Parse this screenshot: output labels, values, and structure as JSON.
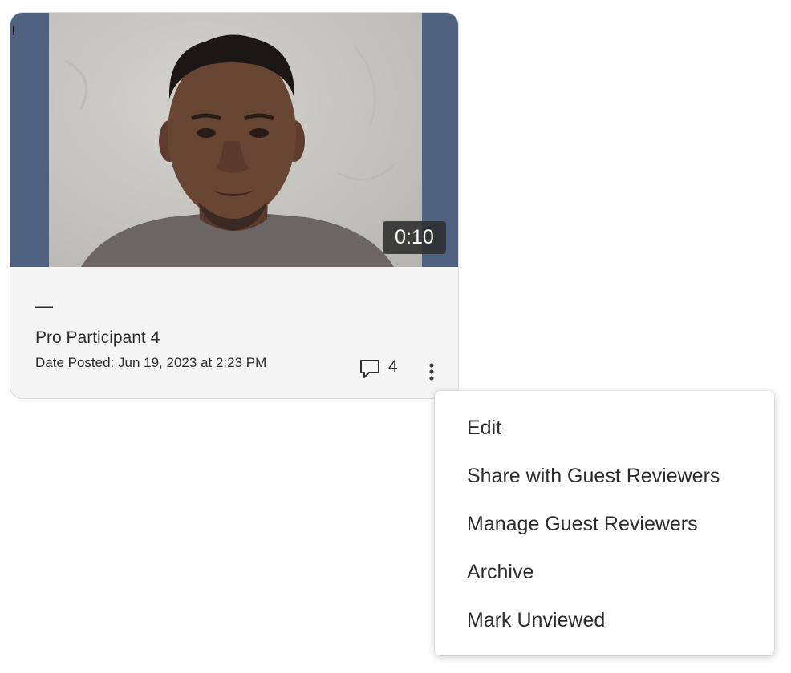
{
  "card": {
    "duration": "0:10",
    "title_placeholder": "—",
    "participant": "Pro Participant 4",
    "date_posted": "Date Posted: Jun 19, 2023 at 2:23 PM",
    "comment_count": "4",
    "icons": {
      "comment": "comment-icon",
      "more": "more-vertical-icon"
    }
  },
  "menu": {
    "items": [
      {
        "label": "Edit"
      },
      {
        "label": "Share with Guest Reviewers"
      },
      {
        "label": "Manage Guest Reviewers"
      },
      {
        "label": "Archive"
      },
      {
        "label": "Mark Unviewed"
      }
    ]
  },
  "colors": {
    "letterbox": "#4f6380",
    "card_background": "#f5f5f5",
    "text": "#2b2b2b"
  }
}
